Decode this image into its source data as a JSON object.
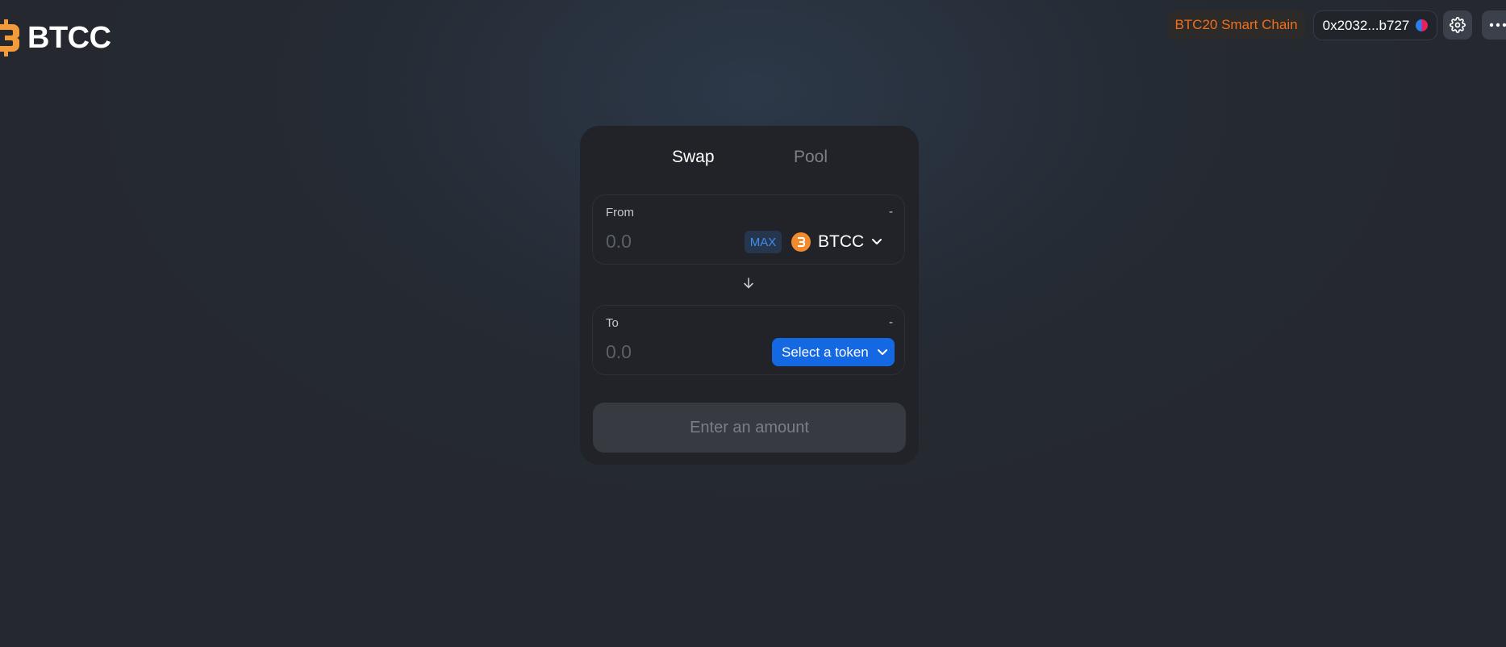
{
  "header": {
    "logo_text": "BTCC",
    "network": "BTC20 Smart Chain",
    "account": "0x2032...b727"
  },
  "icons": {
    "logo": "btcc-logo-icon",
    "avatar": "account-avatar-icon",
    "settings": "gear-icon",
    "more": "more-horizontal-icon",
    "arrow": "arrow-down-icon",
    "chevron": "chevron-down-icon",
    "token": "btcc-token-icon"
  },
  "colors": {
    "accent_orange": "#f06f1c",
    "primary_blue": "#1469e2",
    "max_text": "#3f8cf2"
  },
  "swap": {
    "tabs": [
      {
        "label": "Swap",
        "active": true
      },
      {
        "label": "Pool",
        "active": false
      }
    ],
    "from": {
      "label": "From",
      "balance": "-",
      "placeholder": "0.0",
      "max_label": "MAX",
      "token": "BTCC"
    },
    "to": {
      "label": "To",
      "balance": "-",
      "placeholder": "0.0",
      "select_label": "Select a token"
    },
    "submit_label": "Enter an amount"
  }
}
